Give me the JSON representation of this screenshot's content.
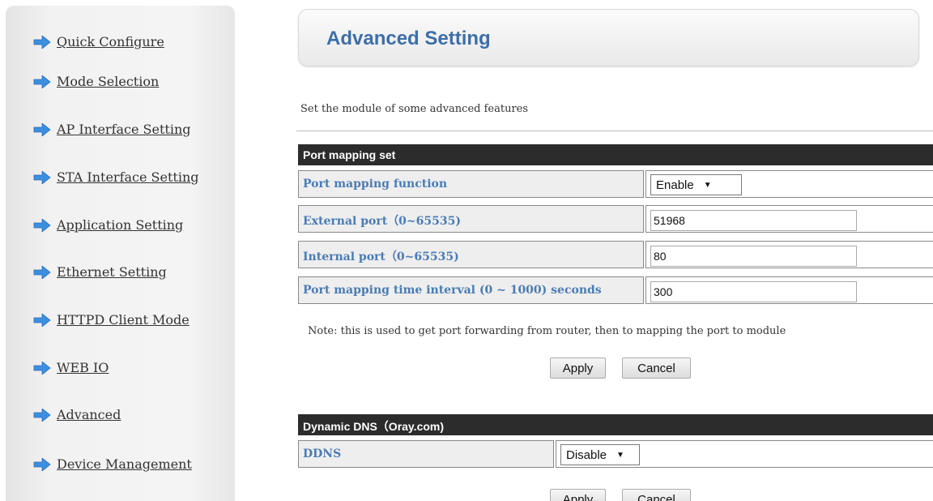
{
  "sidebar": {
    "items": [
      {
        "label": "Quick Configure"
      },
      {
        "label": "Mode Selection"
      },
      {
        "label": "AP Interface Setting"
      },
      {
        "label": "STA Interface Setting"
      },
      {
        "label": "Application Setting"
      },
      {
        "label": "Ethernet Setting"
      },
      {
        "label": "HTTPD Client Mode"
      },
      {
        "label": "WEB IO"
      },
      {
        "label": "Advanced"
      },
      {
        "label": "Device Management"
      }
    ],
    "arrow_color": "#3a8fe0"
  },
  "header": {
    "title": "Advanced Setting"
  },
  "intro": "Set the module of some advanced features",
  "port_mapping": {
    "heading": "Port mapping set",
    "function_label": "Port mapping function",
    "function_value": "Enable",
    "external_label": "External port（0~65535)",
    "external_value": "51968",
    "internal_label": "Internal port（0~65535)",
    "internal_value": "80",
    "interval_label": "Port mapping time interval (0 ~ 1000) seconds",
    "interval_value": "300",
    "note": "Note: this is used to get port forwarding from router, then to mapping the port to module",
    "apply_label": "Apply",
    "cancel_label": "Cancel"
  },
  "ddns": {
    "heading": "Dynamic DNS（Oray.com)",
    "label": "DDNS",
    "value": "Disable",
    "apply_label": "Apply",
    "cancel_label": "Cancel"
  }
}
